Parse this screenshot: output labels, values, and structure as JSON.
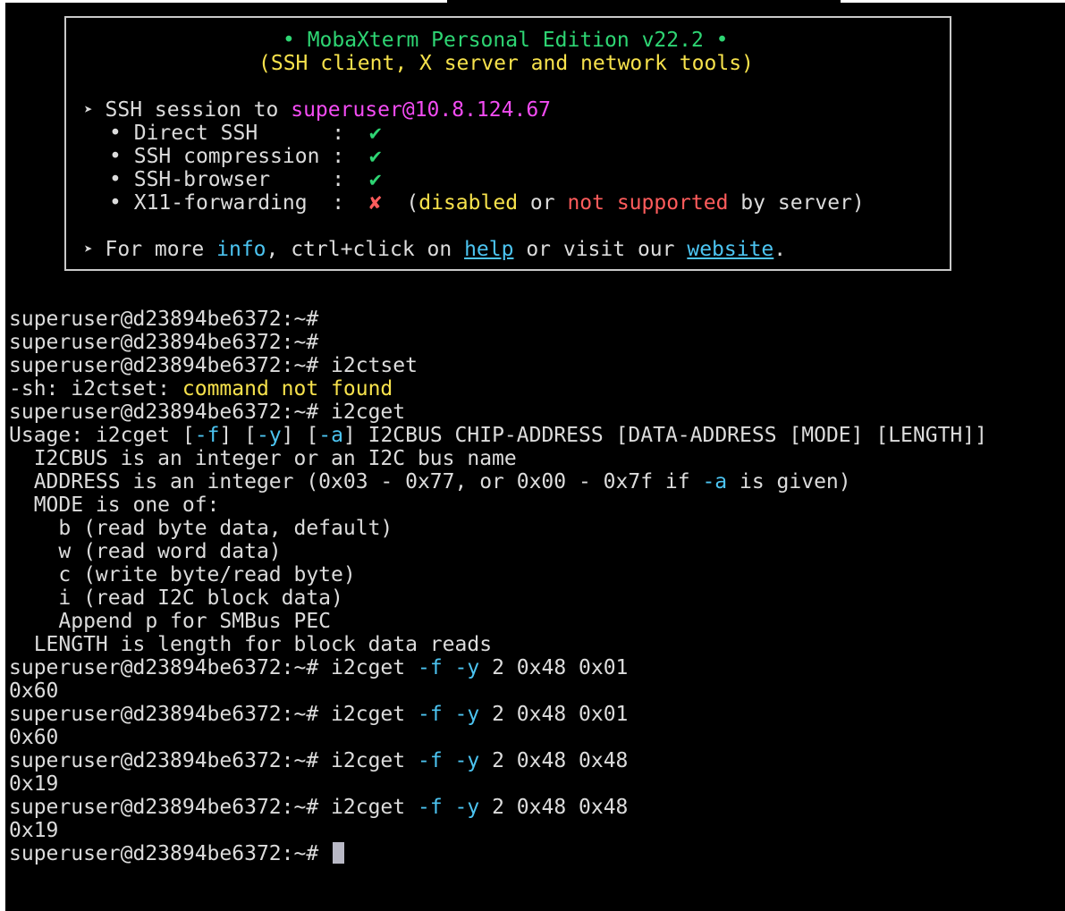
{
  "banner": {
    "title": "• MobaXterm Personal Edition v22.2 •",
    "subtitle": "(SSH client, X server and network tools)",
    "session_arrow": "➤",
    "session_prefix": "SSH session to ",
    "session_host": "superuser@10.8.124.67",
    "features": [
      {
        "bullet": "•",
        "name": "Direct SSH      ",
        "sep": ":",
        "status": "✔"
      },
      {
        "bullet": "•",
        "name": "SSH compression ",
        "sep": ":",
        "status": "✔"
      },
      {
        "bullet": "•",
        "name": "SSH-browser     ",
        "sep": ":",
        "status": "✔"
      },
      {
        "bullet": "•",
        "name": "X11-forwarding  ",
        "sep": ":",
        "status": "✘"
      }
    ],
    "x11_note": {
      "open": "(",
      "disabled": "disabled",
      "or": " or ",
      "not_supported": "not supported",
      "tail": " by server)"
    },
    "info": {
      "arrow": "➤",
      "prefix": "For more ",
      "info": "info",
      "mid": ", ctrl+click on ",
      "help": "help",
      "mid2": " or visit our ",
      "website": "website",
      "end": "."
    }
  },
  "terminal": {
    "prompt": "superuser@d23894be6372:~#",
    "lines": {
      "l1": "",
      "l2": "",
      "l3_cmd": " i2ctset",
      "l4_pre": "-sh: i2ctset: ",
      "l4_err": "command not found",
      "l5_cmd": " i2cget",
      "usage_a": "Usage: i2cget [",
      "usage_f": "-f",
      "usage_b": "] [",
      "usage_y": "-y",
      "usage_c": "] [",
      "usage_aa": "-a",
      "usage_d": "] I2CBUS CHIP-ADDRESS [DATA-ADDRESS [MODE] [LENGTH]]",
      "u1": "  I2CBUS is an integer or an I2C bus name",
      "u2_a": "  ADDRESS is an integer (0x03 - 0x77, or 0x00 - 0x7f if ",
      "u2_flag": "-a",
      "u2_b": " is given)",
      "u3": "  MODE is one of:",
      "u4": "    b (read byte data, default)",
      "u5": "    w (read word data)",
      "u6": "    c (write byte/read byte)",
      "u7": "    i (read I2C block data)",
      "u8": "    Append p for SMBus PEC",
      "u9": "  LENGTH is length for block data reads",
      "cmd_name": " i2cget ",
      "flag_f": "-f",
      "flag_y": "-y",
      "r1_args": " 2 0x48 0x01",
      "r1_out": "0x60",
      "r2_args": " 2 0x48 0x01",
      "r2_out": "0x60",
      "r3_args": " 2 0x48 0x48",
      "r3_out": "0x19",
      "r4_args": " 2 0x48 0x48",
      "r4_out": "0x19"
    }
  },
  "colors": {
    "background": "#000000",
    "text": "#dcdcdc",
    "green": "#2ed573",
    "yellow": "#f7e24c",
    "magenta": "#f34cf3",
    "red": "#ff5c5c",
    "cyan": "#4cc4f1",
    "cursor": "#b9b9c6"
  }
}
